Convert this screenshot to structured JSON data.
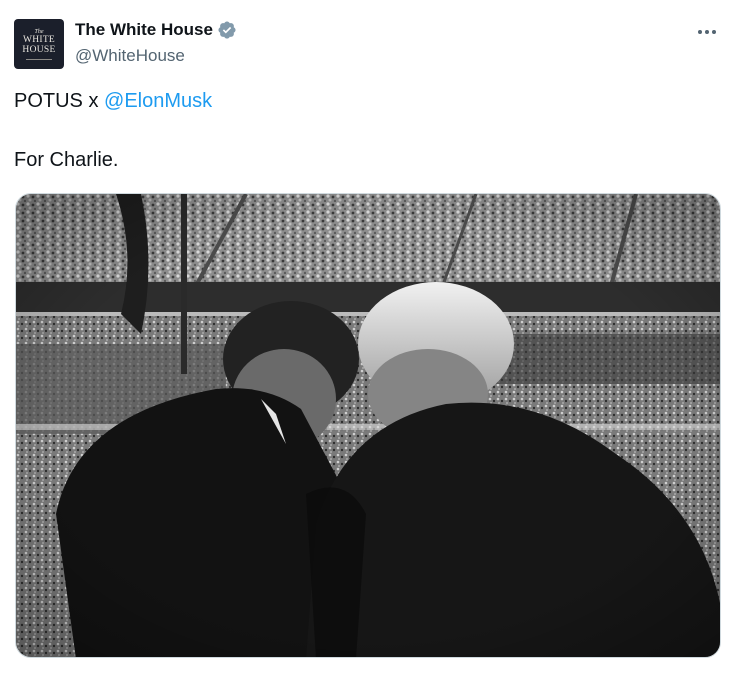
{
  "account": {
    "display_name": "The White House",
    "handle": "@WhiteHouse",
    "verified_icon": "verified-badge-icon",
    "avatar_text": {
      "small": "The",
      "line1": "WHITE",
      "line2": "HOUSE"
    }
  },
  "more_icon": "more-horizontal-icon",
  "tweet": {
    "line1_prefix": "POTUS x ",
    "mention": "@ElonMusk",
    "line2": "For Charlie."
  },
  "colors": {
    "link": "#1d9bf0",
    "secondary_text": "#536471",
    "verified": "#829aab"
  }
}
